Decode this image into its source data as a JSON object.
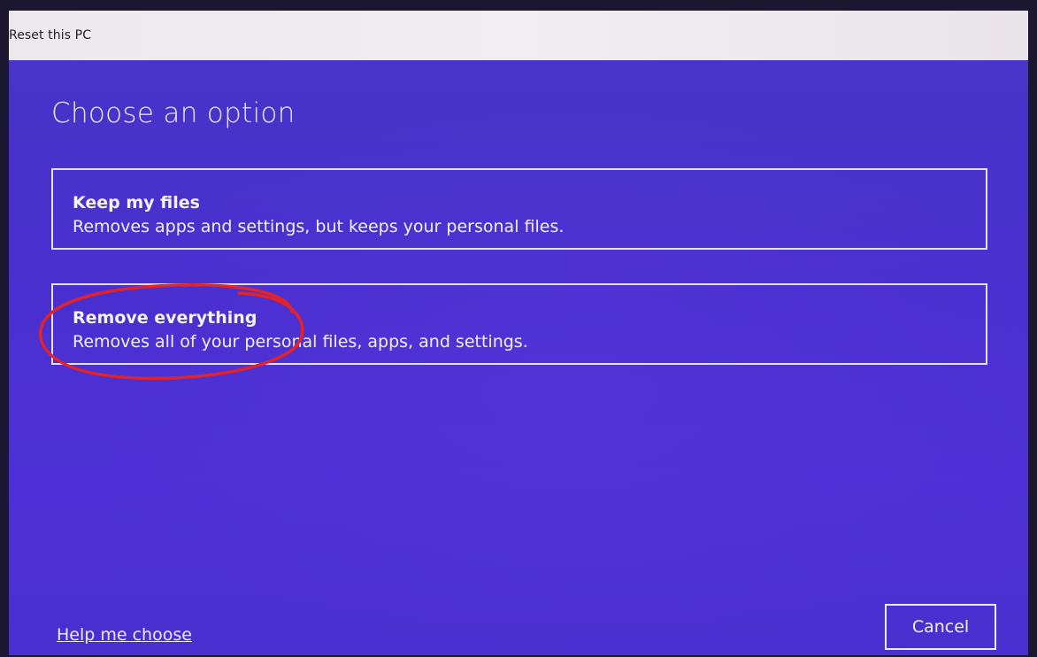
{
  "window": {
    "title": "Reset this PC"
  },
  "main": {
    "heading": "Choose an option",
    "options": [
      {
        "title": "Keep my files",
        "description": "Removes apps and settings, but keeps your personal files."
      },
      {
        "title": "Remove everything",
        "description": "Removes all of your personal files, apps, and settings."
      }
    ]
  },
  "footer": {
    "help_link": "Help me choose",
    "cancel_label": "Cancel"
  },
  "colors": {
    "background": "#4a2fd0",
    "titlebar": "#eeeaee",
    "annotation_circle": "#e0242a"
  }
}
